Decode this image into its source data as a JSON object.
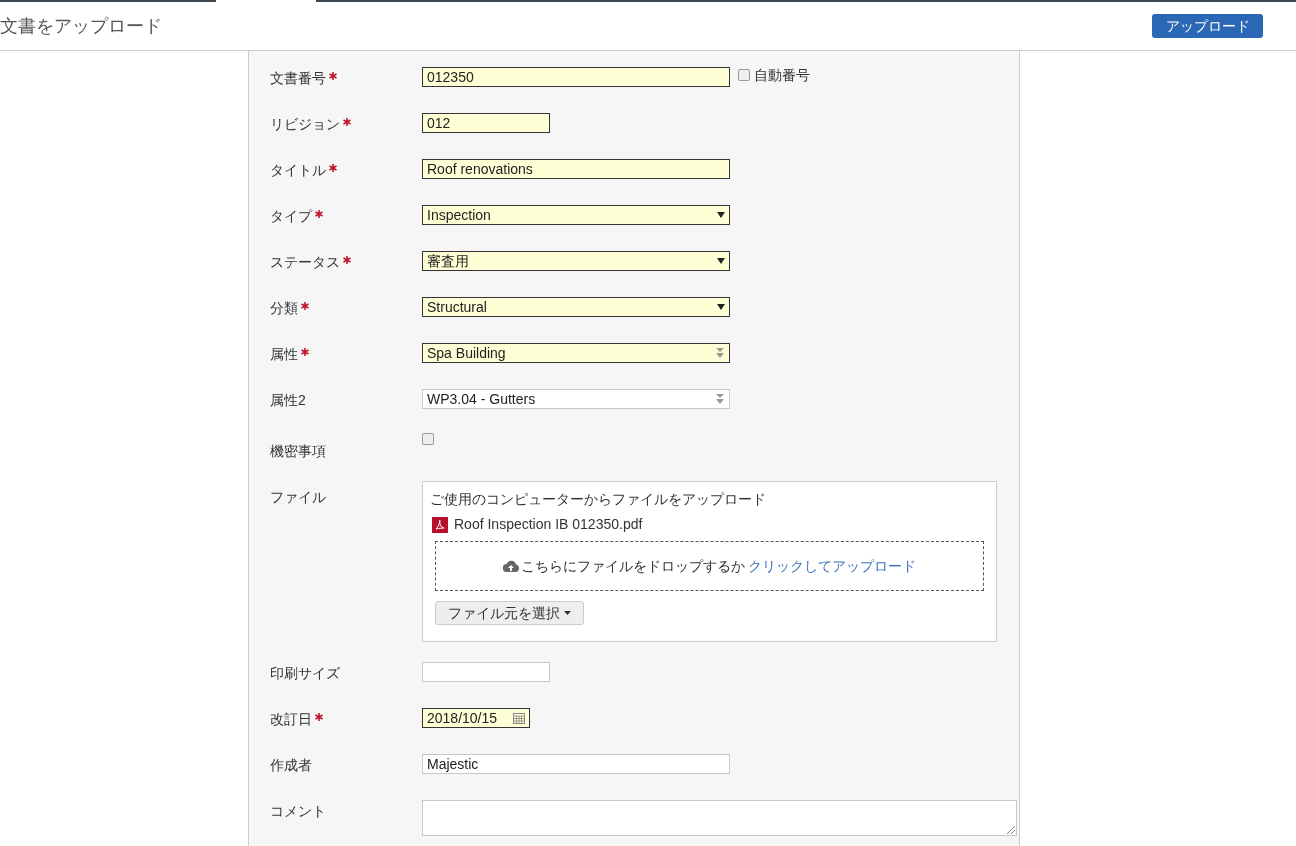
{
  "header": {
    "title": "文書をアップロード",
    "upload_button": "アップロード"
  },
  "fields": [
    {
      "kind": "text",
      "label": "文書番号",
      "required": true,
      "value": "012350",
      "short": false,
      "option": {
        "label": "自動番号",
        "checked": false
      }
    },
    {
      "kind": "text",
      "label": "リビジョン",
      "required": true,
      "value": "012",
      "short": true
    },
    {
      "kind": "text",
      "label": "タイトル",
      "required": true,
      "value": "Roof renovations",
      "short": false
    },
    {
      "kind": "select",
      "label": "タイプ",
      "required": true,
      "value": "Inspection"
    },
    {
      "kind": "select",
      "label": "ステータス",
      "required": true,
      "value": "審査用"
    },
    {
      "kind": "select",
      "label": "分類",
      "required": true,
      "value": "Structural"
    },
    {
      "kind": "combo",
      "label": "属性",
      "required": true,
      "value": "Spa Building"
    },
    {
      "kind": "combo",
      "label": "属性2",
      "required": false,
      "value": "WP3.04 - Gutters"
    },
    {
      "kind": "checkbox",
      "label": "機密事項",
      "checked": false
    },
    {
      "kind": "file",
      "label": "ファイル",
      "required": false,
      "heading": "ご使用のコンピューターからファイルをアップロード",
      "files": [
        {
          "name": "Roof Inspection IB 012350.pdf"
        }
      ],
      "drop_text": "こちらにファイルをドロップするか",
      "drop_link": "クリックしてアップロード",
      "source_button": "ファイル元を選択"
    },
    {
      "kind": "text",
      "label": "印刷サイズ",
      "required": false,
      "short": true
    },
    {
      "kind": "date",
      "label": "改訂日",
      "required": true,
      "value": "2018/10/15"
    },
    {
      "kind": "text",
      "label": "作成者",
      "required": false,
      "value": "Majestic",
      "short": false
    },
    {
      "kind": "textarea",
      "label": "コメント",
      "required": false
    }
  ]
}
